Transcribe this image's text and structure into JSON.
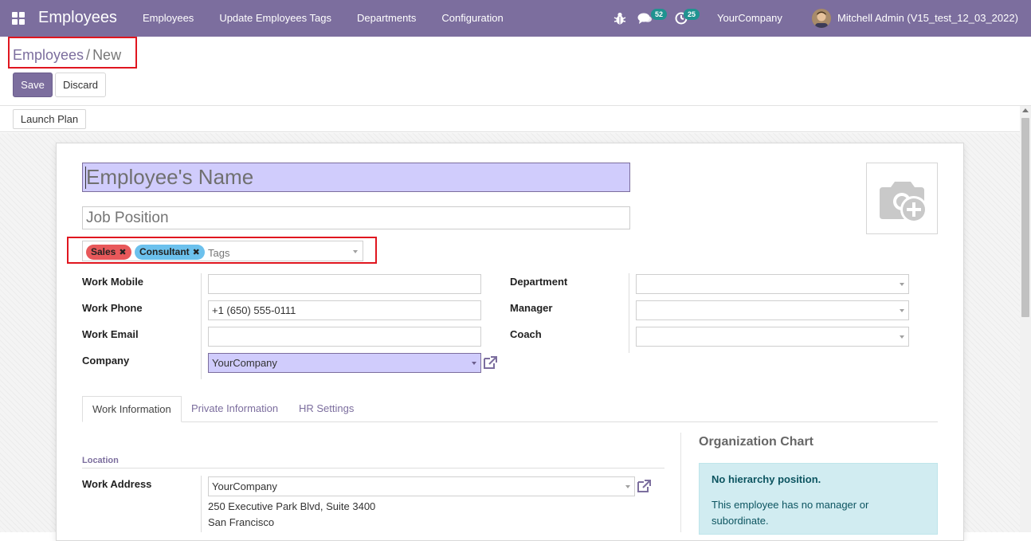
{
  "navbar": {
    "brand": "Employees",
    "menu": [
      "Employees",
      "Update Employees Tags",
      "Departments",
      "Configuration"
    ],
    "messages_count": "52",
    "activities_count": "25",
    "company": "YourCompany",
    "user": "Mitchell Admin (V15_test_12_03_2022)"
  },
  "breadcrumb": {
    "parent": "Employees",
    "separator": "/",
    "current": "New"
  },
  "buttons": {
    "save": "Save",
    "discard": "Discard",
    "launch_plan": "Launch Plan"
  },
  "form": {
    "name_placeholder": "Employee's Name",
    "job_placeholder": "Job Position",
    "tags": [
      {
        "label": "Sales",
        "color": "#e8585a"
      },
      {
        "label": "Consultant",
        "color": "#6cc1ed"
      }
    ],
    "tags_placeholder": "Tags",
    "left_fields": {
      "work_mobile": {
        "label": "Work Mobile",
        "value": ""
      },
      "work_phone": {
        "label": "Work Phone",
        "value": "+1 (650) 555-0111"
      },
      "work_email": {
        "label": "Work Email",
        "value": ""
      },
      "company": {
        "label": "Company",
        "value": "YourCompany"
      }
    },
    "right_fields": {
      "department": {
        "label": "Department",
        "value": ""
      },
      "manager": {
        "label": "Manager",
        "value": ""
      },
      "coach": {
        "label": "Coach",
        "value": ""
      }
    }
  },
  "tabs": [
    "Work Information",
    "Private Information",
    "HR Settings"
  ],
  "work_info": {
    "location_title": "Location",
    "work_address_label": "Work Address",
    "work_address_value": "YourCompany",
    "address_lines": [
      "250 Executive Park Blvd, Suite 3400",
      "San Francisco"
    ]
  },
  "org_chart": {
    "title": "Organization Chart",
    "heading": "No hierarchy position.",
    "text": "This employee has no manager or subordinate."
  },
  "colors": {
    "brand": "#7c6e9e",
    "badge": "#1f9390",
    "highlight_box": "#e0161f"
  }
}
